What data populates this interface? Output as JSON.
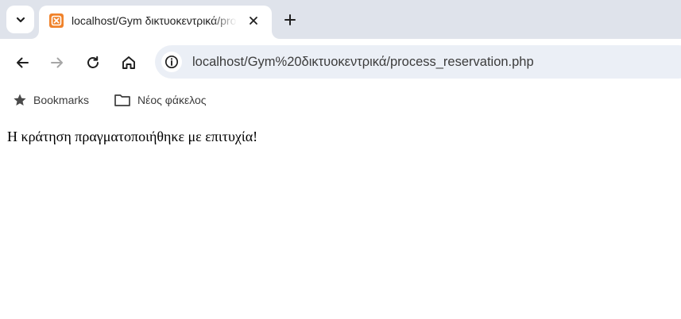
{
  "colors": {
    "tabstrip_bg": "#dfe3eb",
    "omnibox_bg": "#ebeff6",
    "favicon_bg": "#f0822a",
    "text_primary": "#1f1f1f",
    "text_secondary": "#3c3c3c"
  },
  "tabstrip": {
    "tab_search_icon": "chevron-down-icon",
    "active_tab": {
      "favicon_icon": "xampp-favicon-icon",
      "title": "localhost/Gym δικτυοκεντρικά/process_reservation.php",
      "close_icon": "close-icon"
    },
    "new_tab_icon": "plus-icon"
  },
  "toolbar": {
    "back_icon": "arrow-left-icon",
    "forward_icon": "arrow-right-icon",
    "reload_icon": "reload-icon",
    "home_icon": "home-icon",
    "site_info_icon": "info-icon",
    "url": "localhost/Gym%20δικτυοκεντρικά/process_reservation.php"
  },
  "bookmarks_bar": {
    "items": [
      {
        "label": "Bookmarks",
        "icon": "star-icon"
      },
      {
        "label": "Νέος φάκελος",
        "icon": "folder-icon"
      }
    ]
  },
  "page": {
    "message": "Η κράτηση πραγματοποιήθηκε με επιτυχία!"
  }
}
